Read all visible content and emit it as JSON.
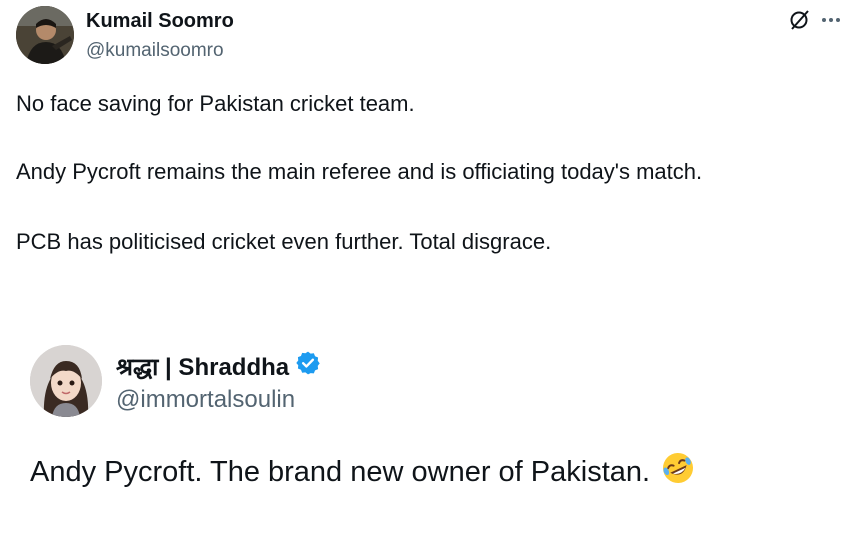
{
  "tweet": {
    "author_name": "Kumail Soomro",
    "author_handle": "@kumailsoomro",
    "lines": [
      "No face saving for Pakistan cricket team.",
      "Andy Pycroft remains the main referee and is officiating today's match.",
      "PCB has politicised cricket even further. Total disgrace."
    ],
    "icons": [
      "grok-icon",
      "more-icon"
    ]
  },
  "quoted_tweet": {
    "author_name": "श्रद्धा | Shraddha",
    "author_handle": "@immortalsoulin",
    "verified": true,
    "text": "Andy Pycroft. The brand new owner of Pakistan.",
    "emoji": "rolling-on-floor-laughing-emoji"
  },
  "colors": {
    "text": "#0f1419",
    "secondary_text": "#536471",
    "verified_badge": "#1d9bf0"
  }
}
